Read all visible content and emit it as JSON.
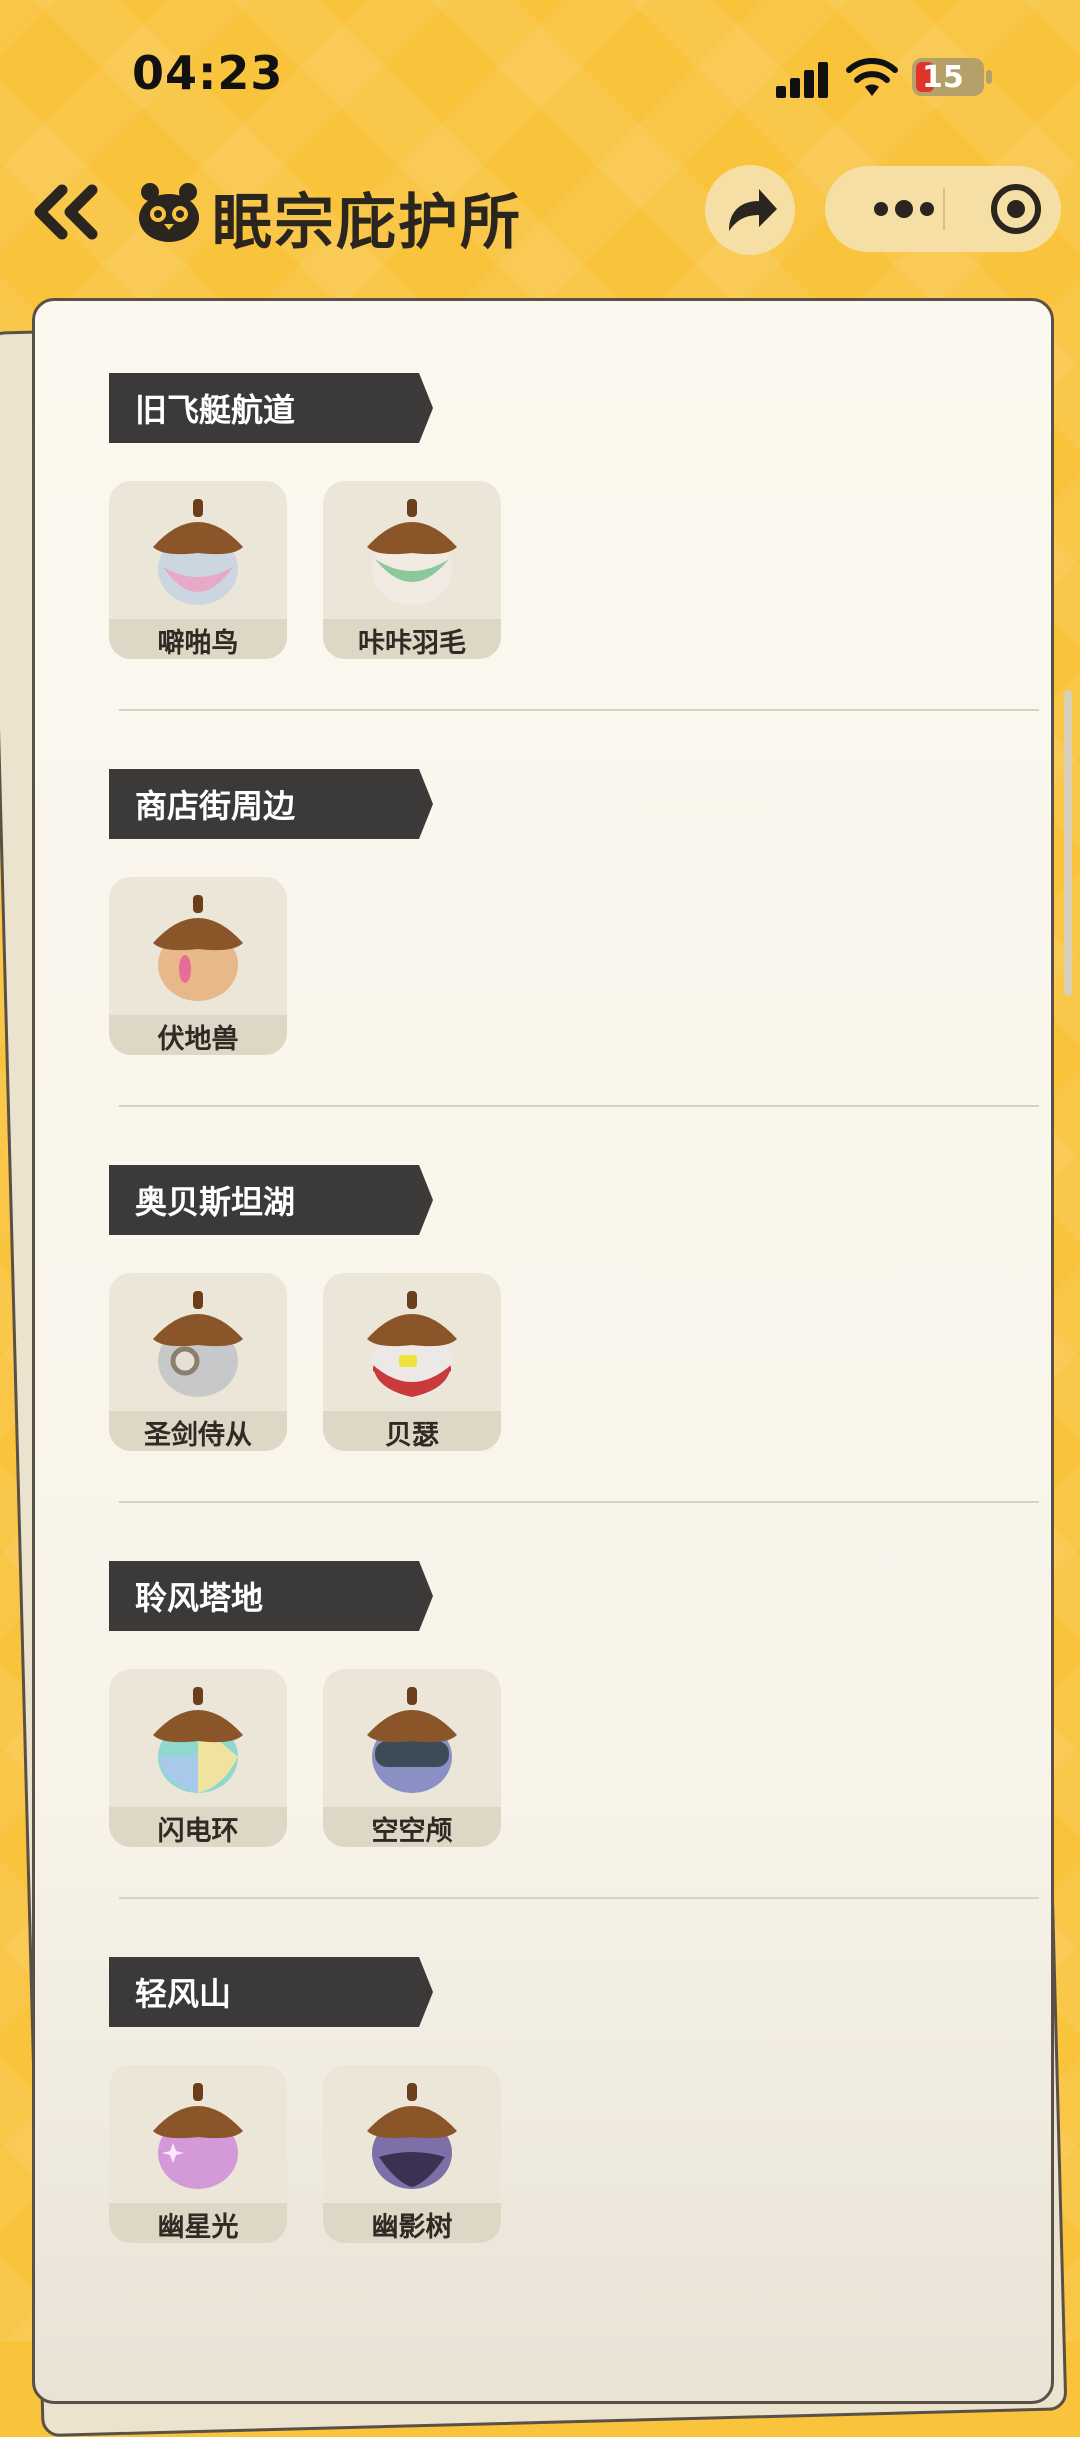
{
  "status_bar": {
    "time": "04:23",
    "battery": "15"
  },
  "header": {
    "title": "眠宗庇护所"
  },
  "icons": {
    "back": "double-chevron-left-icon",
    "logo": "owl-mascot-icon",
    "share": "share-arrow-icon",
    "more": "more-dots-icon",
    "close": "target-circle-icon"
  },
  "colors": {
    "background": "#f9c33c",
    "tag": "#3b3a39",
    "paper": "#fbf8ef"
  },
  "sections": [
    {
      "title": "旧飞艇航道",
      "items": [
        {
          "name": "噼啪鸟",
          "color": "#e8a8c8"
        },
        {
          "name": "咔咔羽毛",
          "color": "#8bc99a"
        }
      ]
    },
    {
      "title": "商店街周边",
      "items": [
        {
          "name": "伏地兽",
          "color": "#e7b98a"
        }
      ]
    },
    {
      "title": "奥贝斯坦湖",
      "items": [
        {
          "name": "圣剑侍从",
          "color": "#c7c8c9"
        },
        {
          "name": "贝瑟",
          "color": "#c93b3b"
        }
      ]
    },
    {
      "title": "聆风塔地",
      "items": [
        {
          "name": "闪电环",
          "color": "#8fd8d0"
        },
        {
          "name": "空空颅",
          "color": "#4b5b6b"
        }
      ]
    },
    {
      "title": "轻风山",
      "items": [
        {
          "name": "幽星光",
          "color": "#d49ad8"
        },
        {
          "name": "幽影树",
          "color": "#7d6fa8"
        }
      ]
    }
  ]
}
